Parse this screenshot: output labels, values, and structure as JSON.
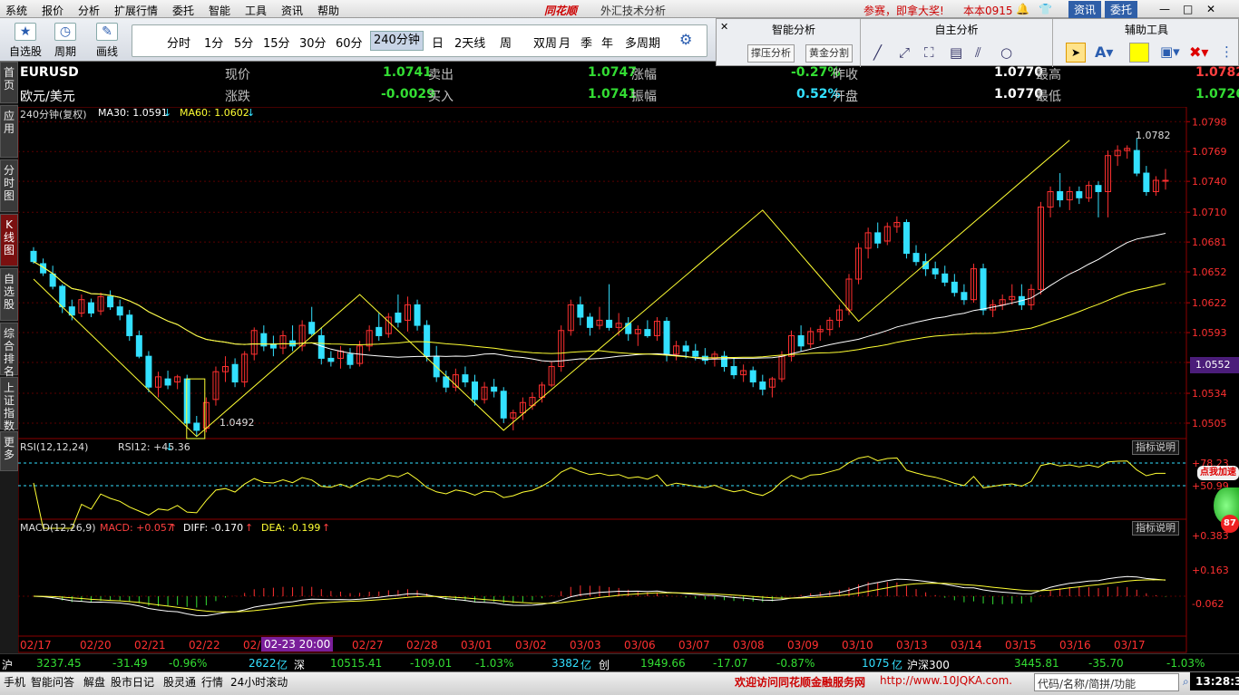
{
  "menu": [
    "系统",
    "报价",
    "分析",
    "扩展行情",
    "委托",
    "智能",
    "工具",
    "资讯",
    "帮助"
  ],
  "app_title": "外汇技术分析",
  "brand_logo": "同花顺",
  "promo": {
    "text": "参赛，即拿大奖!",
    "version": "本本0915",
    "news_btn": "资讯",
    "trade_btn": "委托"
  },
  "toolbar": {
    "watchlist": "自选股",
    "cycle": "周期",
    "draw": "画线"
  },
  "periods": [
    "分时",
    "1分",
    "5分",
    "15分",
    "30分",
    "60分",
    "240分钟",
    "日",
    "2天线",
    "周",
    "双周",
    "月",
    "季",
    "年",
    "多周期"
  ],
  "selected_period": "240分钟",
  "panel": {
    "smart_title": "智能分析",
    "custom_title": "自主分析",
    "aux_title": "辅助工具",
    "support_btn": "撑压分析",
    "golden_btn": "黄金分割",
    "color_swatch": "#ffff00"
  },
  "left_tabs": [
    "首页",
    "应用",
    "分时图",
    "K线图",
    "自选股",
    "综合排名",
    "上证指数",
    "更多"
  ],
  "quote": {
    "symbol": "EURUSD",
    "name": "欧元/美元",
    "price_label": "现价",
    "price": "1.0741",
    "change_label": "涨跌",
    "change": "-0.0029",
    "ask_label": "卖出",
    "ask": "1.0747",
    "bid_label": "买入",
    "bid": "1.0741",
    "pct_label": "涨幅",
    "pct": "-0.27%",
    "amp_label": "振幅",
    "amp": "0.52%",
    "prev_label": "昨收",
    "prev": "1.0770",
    "open_label": "开盘",
    "open": "1.0770",
    "high_label": "最高",
    "high": "1.0782",
    "low_label": "最低",
    "low": "1.0726"
  },
  "main_indicator": {
    "period": "240分钟(复权)",
    "ma30": "MA30: 1.0591",
    "ma60": "MA60: 1.0602"
  },
  "price_axis": [
    "1.0798",
    "1.0769",
    "1.0740",
    "1.0710",
    "1.0681",
    "1.0652",
    "1.0622",
    "1.0593",
    "1.0564",
    "1.0534",
    "1.0505"
  ],
  "current_price_tag": "1.0552",
  "high_mark": "1.0782",
  "low_mark": "1.0492",
  "rsi": {
    "label": "RSI(12,12,24)",
    "value": "RSI12: +45.36",
    "axis_top": "+78.23",
    "axis_mid": "+50.99",
    "help": "指标说明"
  },
  "macd": {
    "label": "MACD(12,26,9)",
    "macd": "MACD: +0.057",
    "diff": "DIFF: -0.170",
    "dea": "DEA: -0.199",
    "axis": [
      "+0.383",
      "+0.163",
      "-0.062"
    ],
    "help": "指标说明"
  },
  "promo_badge": {
    "text": "点我加速",
    "num": "87"
  },
  "dates": [
    "02/17",
    "02/20",
    "02/21",
    "02/22",
    "02/2",
    "03/01",
    "03/02",
    "03/03",
    "03/06",
    "03/07",
    "03/08",
    "03/09",
    "03/10",
    "03/13",
    "03/14",
    "03/15",
    "03/16",
    "03/17",
    "02/27",
    "02/28"
  ],
  "cursor_date": "02-23 20:00",
  "status": {
    "sh_label": "沪",
    "sh": "3237.45",
    "sh_chg": "-31.49",
    "sh_pct": "-0.96%",
    "sh_amt": "2622",
    "sh_unit": "亿",
    "sz_label": "深",
    "sz": "10515.41",
    "sz_chg": "-109.01",
    "sz_pct": "-1.03%",
    "sz_amt": "3382",
    "sz_unit": "亿",
    "cy_label": "创",
    "cy": "1949.66",
    "cy_chg": "-17.07",
    "cy_pct": "-0.87%",
    "cy_amt": "1075",
    "cy_unit": "亿",
    "hs_label": "沪深300",
    "hs": "3445.81",
    "hs_chg": "-35.70",
    "hs_pct": "-1.03%"
  },
  "bottom": {
    "items": [
      "手机",
      "智能问答",
      "解盘",
      "股市日记",
      "股灵通",
      "行情",
      "24小时滚动"
    ],
    "welcome": "欢迎访问同花顺金融服务网",
    "url": "http://www.10JQKA.com.",
    "search": "代码/名称/简拼/功能",
    "time": "13:28:34"
  },
  "chart_data": {
    "type": "candlestick",
    "symbol": "EURUSD",
    "period": "240分钟",
    "ylim": [
      1.049,
      1.08
    ],
    "x_dates": [
      "02/17",
      "02/20",
      "02/21",
      "02/22",
      "02/23",
      "02/27",
      "02/28",
      "03/01",
      "03/02",
      "03/03",
      "03/06",
      "03/07",
      "03/08",
      "03/09",
      "03/10",
      "03/13",
      "03/14",
      "03/15",
      "03/16",
      "03/17"
    ],
    "candles": [
      [
        1.0672,
        1.0676,
        1.066,
        1.0662
      ],
      [
        1.066,
        1.0665,
        1.0648,
        1.0651
      ],
      [
        1.065,
        1.0658,
        1.0635,
        1.0638
      ],
      [
        1.0638,
        1.064,
        1.0612,
        1.0618
      ],
      [
        1.0618,
        1.0625,
        1.0605,
        1.061
      ],
      [
        1.0612,
        1.063,
        1.0608,
        1.0625
      ],
      [
        1.0622,
        1.0626,
        1.0608,
        1.0612
      ],
      [
        1.0614,
        1.0632,
        1.061,
        1.0628
      ],
      [
        1.0628,
        1.0634,
        1.0615,
        1.0618
      ],
      [
        1.0618,
        1.0625,
        1.0605,
        1.061
      ],
      [
        1.061,
        1.0615,
        1.0585,
        1.059
      ],
      [
        1.059,
        1.0595,
        1.0568,
        1.057
      ],
      [
        1.057,
        1.0575,
        1.0535,
        1.054
      ],
      [
        1.054,
        1.0555,
        1.053,
        1.055
      ],
      [
        1.0548,
        1.0556,
        1.0538,
        1.0542
      ],
      [
        1.0545,
        1.0552,
        1.0538,
        1.055
      ],
      [
        1.0548,
        1.0552,
        1.05,
        1.0505
      ],
      [
        1.0505,
        1.0512,
        1.0492,
        1.0498
      ],
      [
        1.05,
        1.053,
        1.0496,
        1.0525
      ],
      [
        1.0528,
        1.056,
        1.0522,
        1.0555
      ],
      [
        1.0555,
        1.057,
        1.0545,
        1.056
      ],
      [
        1.0562,
        1.0568,
        1.054,
        1.0545
      ],
      [
        1.0545,
        1.0575,
        1.054,
        1.0572
      ],
      [
        1.0572,
        1.0598,
        1.0566,
        1.0595
      ],
      [
        1.0592,
        1.06,
        1.0575,
        1.058
      ],
      [
        1.0582,
        1.059,
        1.057,
        1.0578
      ],
      [
        1.0578,
        1.0595,
        1.0572,
        1.059
      ],
      [
        1.0585,
        1.06,
        1.0575,
        1.058
      ],
      [
        1.058,
        1.0605,
        1.0575,
        1.06
      ],
      [
        1.0603,
        1.0618,
        1.059,
        1.0592
      ],
      [
        1.059,
        1.0598,
        1.0562,
        1.0568
      ],
      [
        1.0568,
        1.0575,
        1.056,
        1.0565
      ],
      [
        1.0568,
        1.058,
        1.0558,
        1.0575
      ],
      [
        1.0572,
        1.0578,
        1.0558,
        1.0562
      ],
      [
        1.0563,
        1.0585,
        1.056,
        1.058
      ],
      [
        1.058,
        1.06,
        1.0575,
        1.0595
      ],
      [
        1.0598,
        1.0612,
        1.0585,
        1.059
      ],
      [
        1.0592,
        1.0612,
        1.0588,
        1.0608
      ],
      [
        1.0612,
        1.063,
        1.0598,
        1.0603
      ],
      [
        1.0605,
        1.0628,
        1.0594,
        1.062
      ],
      [
        1.062,
        1.0625,
        1.0595,
        1.06
      ],
      [
        1.06,
        1.0605,
        1.0565,
        1.057
      ],
      [
        1.057,
        1.058,
        1.0545,
        1.055
      ],
      [
        1.055,
        1.0556,
        1.0535,
        1.054
      ],
      [
        1.054,
        1.0558,
        1.0536,
        1.0552
      ],
      [
        1.0552,
        1.056,
        1.054,
        1.0545
      ],
      [
        1.0545,
        1.0552,
        1.0522,
        1.0528
      ],
      [
        1.0528,
        1.0545,
        1.0524,
        1.054
      ],
      [
        1.054,
        1.0548,
        1.053,
        1.0536
      ],
      [
        1.0536,
        1.054,
        1.0505,
        1.051
      ],
      [
        1.051,
        1.0518,
        1.0498,
        1.0515
      ],
      [
        1.0515,
        1.053,
        1.0508,
        1.0525
      ],
      [
        1.0522,
        1.0535,
        1.0518,
        1.053
      ],
      [
        1.053,
        1.0545,
        1.0525,
        1.0542
      ],
      [
        1.0542,
        1.0565,
        1.054,
        1.056
      ],
      [
        1.056,
        1.06,
        1.0555,
        1.0595
      ],
      [
        1.0595,
        1.0625,
        1.059,
        1.062
      ],
      [
        1.062,
        1.0628,
        1.06,
        1.0608
      ],
      [
        1.0608,
        1.0612,
        1.059,
        1.0598
      ],
      [
        1.06,
        1.0618,
        1.0596,
        1.0605
      ],
      [
        1.0605,
        1.064,
        1.0595,
        1.0598
      ],
      [
        1.0598,
        1.0612,
        1.059,
        1.0602
      ],
      [
        1.0602,
        1.0608,
        1.0585,
        1.0592
      ],
      [
        1.0592,
        1.06,
        1.058,
        1.0596
      ],
      [
        1.0596,
        1.0605,
        1.0588,
        1.059
      ],
      [
        1.059,
        1.0608,
        1.0585,
        1.0604
      ],
      [
        1.0604,
        1.0608,
        1.0565,
        1.0572
      ],
      [
        1.0572,
        1.0585,
        1.0566,
        1.058
      ],
      [
        1.058,
        1.0585,
        1.0568,
        1.0575
      ],
      [
        1.0575,
        1.0582,
        1.0566,
        1.057
      ],
      [
        1.057,
        1.0578,
        1.0562,
        1.0566
      ],
      [
        1.0568,
        1.0575,
        1.056,
        1.0572
      ],
      [
        1.057,
        1.0575,
        1.0555,
        1.056
      ],
      [
        1.056,
        1.0568,
        1.0548,
        1.0552
      ],
      [
        1.0552,
        1.0562,
        1.0545,
        1.0556
      ],
      [
        1.0556,
        1.056,
        1.054,
        1.0545
      ],
      [
        1.0545,
        1.0552,
        1.0532,
        1.0538
      ],
      [
        1.054,
        1.055,
        1.053,
        1.0548
      ],
      [
        1.0548,
        1.0575,
        1.0545,
        1.057
      ],
      [
        1.057,
        1.0595,
        1.0565,
        1.059
      ],
      [
        1.059,
        1.06,
        1.0575,
        1.058
      ],
      [
        1.0582,
        1.0598,
        1.0578,
        1.0594
      ],
      [
        1.0594,
        1.06,
        1.0585,
        1.0596
      ],
      [
        1.0596,
        1.0608,
        1.059,
        1.0605
      ],
      [
        1.0605,
        1.062,
        1.0598,
        1.0615
      ],
      [
        1.0615,
        1.065,
        1.061,
        1.0645
      ],
      [
        1.0645,
        1.068,
        1.064,
        1.0675
      ],
      [
        1.0675,
        1.0695,
        1.0665,
        1.069
      ],
      [
        1.069,
        1.07,
        1.0675,
        1.068
      ],
      [
        1.0682,
        1.07,
        1.0678,
        1.0696
      ],
      [
        1.0696,
        1.0706,
        1.069,
        1.07
      ],
      [
        1.07,
        1.0703,
        1.0665,
        1.067
      ],
      [
        1.067,
        1.0678,
        1.0658,
        1.0662
      ],
      [
        1.0662,
        1.067,
        1.0648,
        1.0655
      ],
      [
        1.0655,
        1.0662,
        1.0645,
        1.065
      ],
      [
        1.065,
        1.0658,
        1.0638,
        1.0642
      ],
      [
        1.0642,
        1.065,
        1.0628,
        1.0632
      ],
      [
        1.0632,
        1.064,
        1.062,
        1.0625
      ],
      [
        1.0625,
        1.066,
        1.0622,
        1.0655
      ],
      [
        1.0655,
        1.066,
        1.061,
        1.0615
      ],
      [
        1.0615,
        1.0625,
        1.0608,
        1.062
      ],
      [
        1.062,
        1.063,
        1.0615,
        1.0625
      ],
      [
        1.0625,
        1.064,
        1.062,
        1.0628
      ],
      [
        1.0628,
        1.064,
        1.0615,
        1.062
      ],
      [
        1.062,
        1.064,
        1.0615,
        1.0635
      ],
      [
        1.0635,
        1.072,
        1.063,
        1.0715
      ],
      [
        1.0715,
        1.0735,
        1.0705,
        1.073
      ],
      [
        1.073,
        1.0748,
        1.0715,
        1.0722
      ],
      [
        1.0722,
        1.0735,
        1.0712,
        1.073
      ],
      [
        1.073,
        1.0735,
        1.0718,
        1.0724
      ],
      [
        1.0724,
        1.074,
        1.072,
        1.0736
      ],
      [
        1.0736,
        1.074,
        1.0705,
        1.073
      ],
      [
        1.073,
        1.077,
        1.0705,
        1.0765
      ],
      [
        1.0765,
        1.0775,
        1.0755,
        1.077
      ],
      [
        1.077,
        1.0775,
        1.0762,
        1.0772
      ],
      [
        1.077,
        1.0782,
        1.0745,
        1.0748
      ],
      [
        1.0748,
        1.0755,
        1.0726,
        1.073
      ],
      [
        1.073,
        1.0745,
        1.0726,
        1.0741
      ],
      [
        1.0741,
        1.0752,
        1.0732,
        1.0741
      ]
    ]
  }
}
